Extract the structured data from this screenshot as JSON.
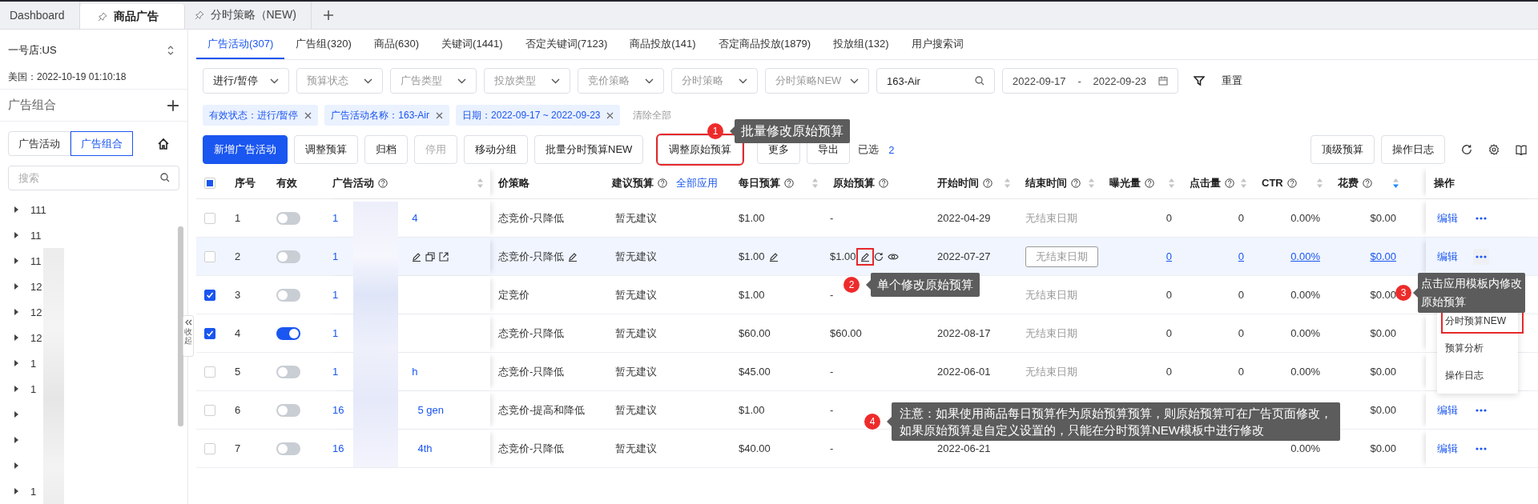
{
  "tabs": [
    {
      "label": "Dashboard",
      "selected": false,
      "pinned": false
    },
    {
      "label": "商品广告",
      "selected": true,
      "pinned": true
    },
    {
      "label": "分时策略（NEW)",
      "selected": false,
      "pinned": true
    }
  ],
  "sidebar": {
    "store": "一号店:US",
    "time": "美国：2022-10-19 01:10:18",
    "section_title": "广告组合",
    "segments": [
      {
        "label": "广告活动",
        "selected": false
      },
      {
        "label": "广告组合",
        "selected": true
      }
    ],
    "search": {
      "placeholder": "搜索"
    },
    "tree": [
      {
        "label": "111",
        "expanded": false
      },
      {
        "label": "11",
        "expanded": false
      },
      {
        "label": "11",
        "expanded": false
      },
      {
        "label": "12",
        "expanded": false
      },
      {
        "label": "12",
        "expanded": false
      },
      {
        "label": "12",
        "expanded": false
      },
      {
        "label": "1",
        "expanded": false
      },
      {
        "label": "1",
        "expanded": false
      },
      {
        "expanded": false
      },
      {
        "expanded": false
      },
      {
        "expanded": false
      },
      {
        "label": "1",
        "expanded": false
      }
    ],
    "collapse_label": "收起"
  },
  "sub_tabs": [
    {
      "label": "广告活动(307)",
      "selected": true
    },
    {
      "label": "广告组(320)",
      "selected": false
    },
    {
      "label": "商品(630)",
      "selected": false
    },
    {
      "label": "关键词(1441)",
      "selected": false
    },
    {
      "label": "否定关键词(7123)",
      "selected": false
    },
    {
      "label": "商品投放(141)",
      "selected": false
    },
    {
      "label": "否定商品投放(1879)",
      "selected": false
    },
    {
      "label": "投放组(132)",
      "selected": false
    },
    {
      "label": "用户搜索词",
      "selected": false
    }
  ],
  "filters": [
    {
      "kind": "select",
      "value": "进行/暂停"
    },
    {
      "kind": "select",
      "placeholder": "预算状态"
    },
    {
      "kind": "select",
      "placeholder": "广告类型"
    },
    {
      "kind": "select",
      "placeholder": "投放类型"
    },
    {
      "kind": "select",
      "placeholder": "竞价策略"
    },
    {
      "kind": "select",
      "placeholder": "分时策略"
    },
    {
      "kind": "select",
      "placeholder": "分时策略NEW"
    },
    {
      "kind": "search",
      "value": "163-Air"
    },
    {
      "kind": "daterange",
      "start": "2022-09-17",
      "separator": "-",
      "end": "2022-09-23"
    }
  ],
  "reset": "重置",
  "chips": [
    "有效状态：进行/暂停",
    "广告活动名称：163-Air",
    "日期：2022-09-17 ~ 2022-09-23"
  ],
  "clear_all": "清除全部",
  "toolbar": {
    "buttons": [
      {
        "label": "新增广告活动",
        "kind": "primary",
        "highlighted": false
      },
      {
        "label": "调整预算",
        "kind": "default",
        "highlighted": false
      },
      {
        "label": "归档",
        "kind": "default",
        "highlighted": false
      },
      {
        "label": "停用",
        "kind": "disabled",
        "highlighted": false
      },
      {
        "label": "移动分组",
        "kind": "default",
        "highlighted": false
      },
      {
        "label": "批量分时预算NEW",
        "kind": "default",
        "highlighted": false
      },
      {
        "label": "调整原始预算",
        "kind": "default",
        "highlighted": true
      },
      {
        "label": "更多",
        "kind": "default",
        "highlighted": false
      },
      {
        "label": "导出",
        "kind": "default",
        "highlighted": false
      }
    ],
    "selected_label": "已选",
    "selected_count": "2",
    "right_buttons": [
      "顶级预算",
      "操作日志"
    ]
  },
  "table": {
    "select_all_indeterminate": true,
    "columns": [
      {
        "label": "序号",
        "help": false,
        "sortable": false
      },
      {
        "label": "有效",
        "help": false,
        "sortable": false
      },
      {
        "label": "广告活动",
        "help": true,
        "sortable": true
      },
      {
        "label": "价策略",
        "help": false,
        "sortable": false
      },
      {
        "label": "建议预算",
        "help": true,
        "sortable": false,
        "link": "全部应用"
      },
      {
        "label": "每日预算",
        "help": true,
        "sortable": true
      },
      {
        "label": "原始预算",
        "help": true,
        "sortable": false
      },
      {
        "label": "开始时间",
        "help": true,
        "sortable": true
      },
      {
        "label": "结束时间",
        "help": true,
        "sortable": true
      },
      {
        "label": "曝光量",
        "help": true,
        "sortable": true
      },
      {
        "label": "点击量",
        "help": true,
        "sortable": true
      },
      {
        "label": "CTR",
        "help": true,
        "sortable": true
      },
      {
        "label": "花费",
        "help": true,
        "sortable": true,
        "sort_desc": true
      },
      {
        "label": "操作",
        "help": false,
        "sortable": false
      }
    ],
    "rows": [
      {
        "index": "1",
        "checked": false,
        "enabled": false,
        "hovered": false,
        "name_start": "1",
        "name_end": "4",
        "bid": "态竞价-只降低",
        "suggest": "暂无建议",
        "daily": "$1.00",
        "original": "-",
        "start": "2022-04-29",
        "end": "无结束日期",
        "impressions": "0",
        "clicks": "0",
        "ctr": "0.00%",
        "spend": "$0.00",
        "edit": "编辑"
      },
      {
        "index": "2",
        "checked": false,
        "enabled": false,
        "hovered": true,
        "edit_highlighted": true,
        "name_start": "1",
        "bid": "态竞价-只降低",
        "suggest": "暂无建议",
        "daily": "$1.00",
        "original": "$1.00",
        "start": "2022-07-27",
        "end": "无结束日期",
        "impressions": "0",
        "clicks": "0",
        "ctr": "0.00%",
        "spend": "$0.00",
        "edit": "编辑"
      },
      {
        "index": "3",
        "checked": true,
        "enabled": false,
        "hovered": false,
        "name_start": "1",
        "bid": "定竞价",
        "suggest": "暂无建议",
        "daily": "$1.00",
        "original": "-",
        "end": "无结束日期",
        "impressions": "0",
        "clicks": "0",
        "ctr": "0.00%",
        "spend": "$0.00"
      },
      {
        "index": "4",
        "checked": true,
        "enabled": true,
        "hovered": false,
        "name_start": "1",
        "bid": "态竞价-只降低",
        "suggest": "暂无建议",
        "daily": "$60.00",
        "original": "$60.00",
        "start": "2022-08-17",
        "end": "无结束日期",
        "impressions": "0",
        "clicks": "0",
        "ctr": "0.00%",
        "spend": "$0.00"
      },
      {
        "index": "5",
        "checked": false,
        "enabled": false,
        "hovered": false,
        "name_start": "1",
        "name_end": "h",
        "bid": "态竞价-只降低",
        "suggest": "暂无建议",
        "daily": "$45.00",
        "original": "-",
        "start": "2022-06-01",
        "end": "无结束日期",
        "impressions": "0",
        "clicks": "0",
        "ctr": "0.00%",
        "spend": "$0.00"
      },
      {
        "index": "6",
        "checked": false,
        "enabled": false,
        "hovered": false,
        "name_start": "16",
        "name_end": "5 gen",
        "bid": "态竞价-提高和降低",
        "suggest": "暂无建议",
        "daily": "$1.00",
        "original": "-",
        "spend": "$0.00",
        "edit": "编辑"
      },
      {
        "index": "7",
        "checked": false,
        "enabled": false,
        "hovered": false,
        "name_start": "16",
        "name_end": "4th",
        "bid": "态竞价-只降低",
        "suggest": "暂无建议",
        "daily": "$40.00",
        "original": "-",
        "start": "2022-06-21",
        "ctr": "0.00%",
        "spend": "$0.00",
        "edit": "编辑"
      }
    ]
  },
  "row_menu": {
    "items": [
      {
        "label": "分时预算NEW",
        "highlighted": true
      },
      {
        "label": "预算分析",
        "highlighted": false
      },
      {
        "label": "操作日志",
        "highlighted": false
      }
    ]
  },
  "annotations": [
    {
      "number": "1",
      "lines": [
        "批量修改原始预算"
      ]
    },
    {
      "number": "2",
      "lines": [
        "单个修改原始预算"
      ]
    },
    {
      "number": "3",
      "lines": [
        "点击应用模板内修改",
        "原始预算"
      ]
    },
    {
      "number": "4",
      "lines": [
        "注意：如果使用商品每日预算作为原始预算预算，则原始预算可在广告页面修改，",
        "如果原始预算是自定义设置的，只能在分时预算NEW模板中进行修改"
      ]
    }
  ]
}
